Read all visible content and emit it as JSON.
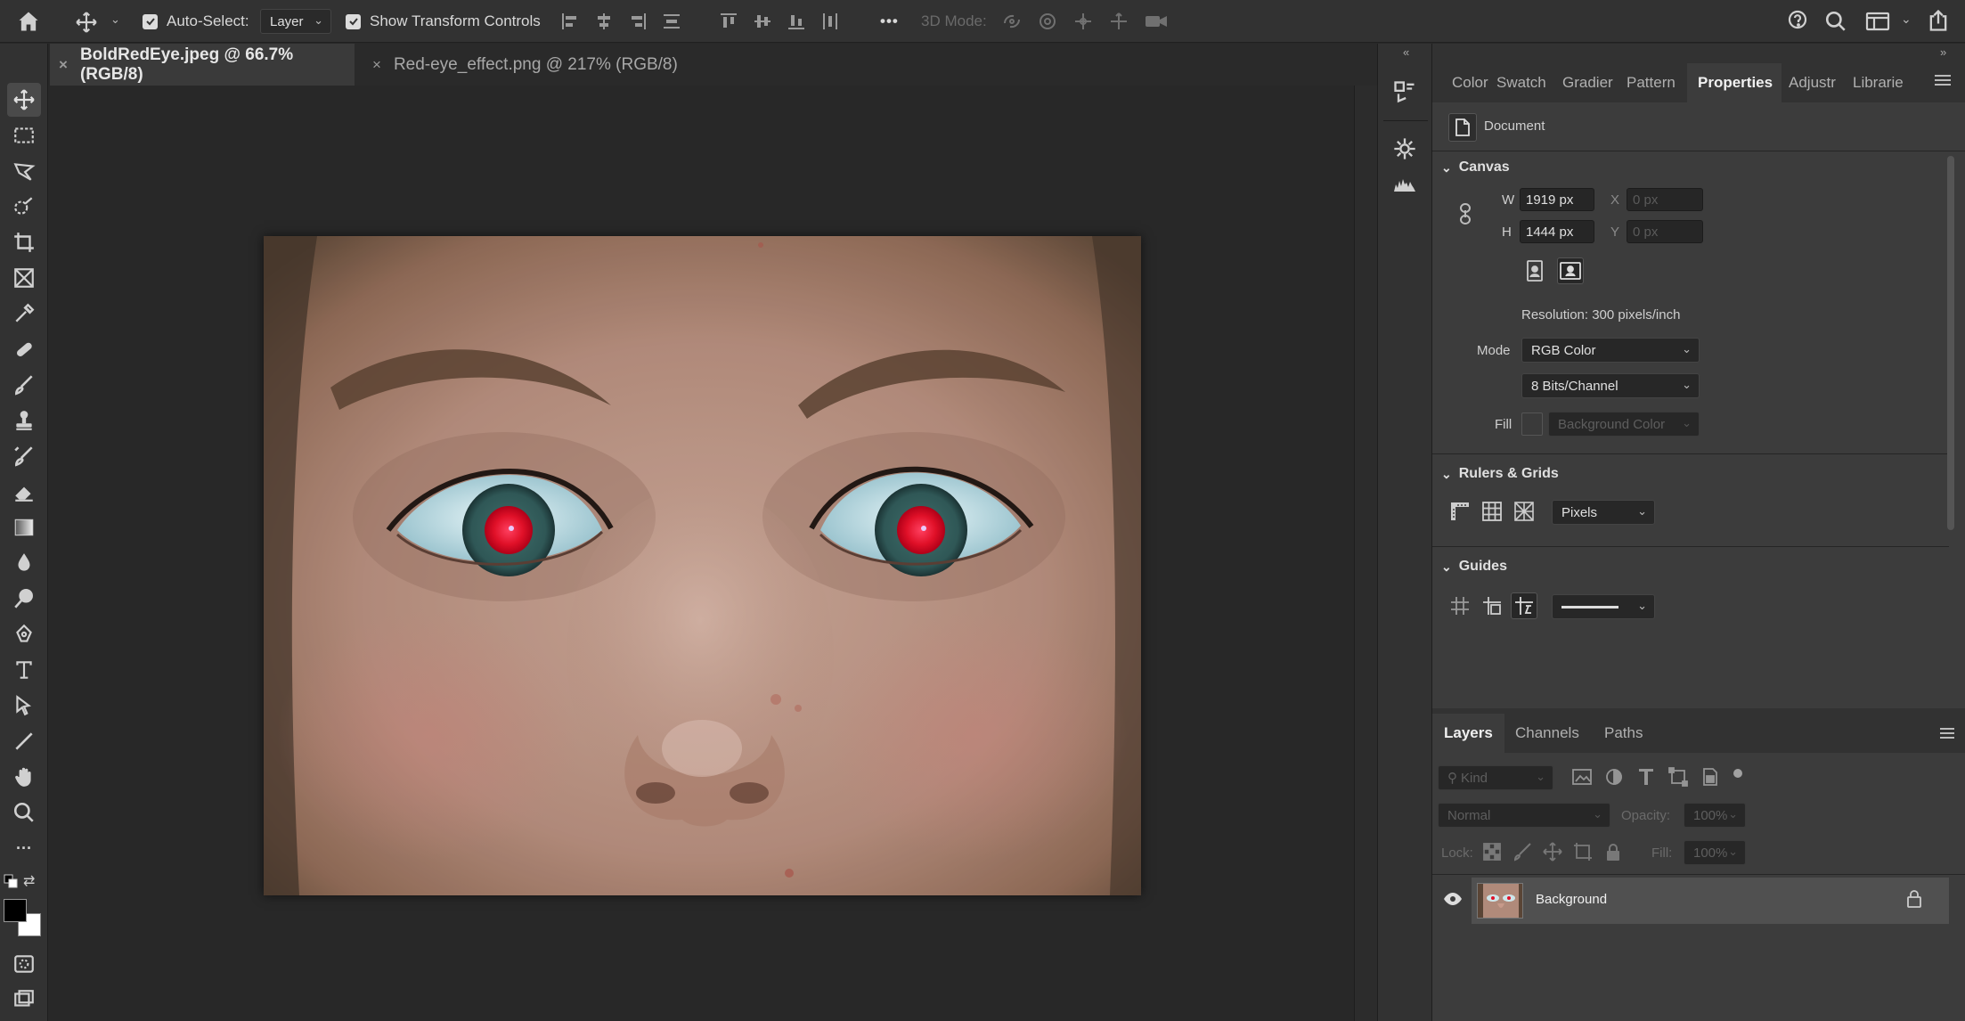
{
  "options_bar": {
    "auto_select_label": "Auto-Select:",
    "auto_select_value": "Layer",
    "show_transform_label": "Show Transform Controls",
    "more": "•••",
    "mode_3d_label": "3D Mode:"
  },
  "documents": {
    "tabs": [
      {
        "close": "×",
        "label": "BoldRedEye.jpeg @ 66.7% (RGB/8)"
      },
      {
        "close": "×",
        "label": "Red-eye_effect.png @ 217% (RGB/8)"
      }
    ]
  },
  "panel_tabs": [
    "Color",
    "Swatch",
    "Gradier",
    "Pattern",
    "Properties",
    "Adjustr",
    "Librarie"
  ],
  "properties": {
    "kind_label": "Document",
    "canvas": {
      "title": "Canvas",
      "w_label": "W",
      "w_value": "1919 px",
      "h_label": "H",
      "h_value": "1444 px",
      "x_label": "X",
      "x_value": "0 px",
      "y_label": "Y",
      "y_value": "0 px",
      "resolution": "Resolution: 300 pixels/inch",
      "mode_label": "Mode",
      "mode_value": "RGB Color",
      "depth_value": "8 Bits/Channel",
      "fill_label": "Fill",
      "fill_value": "Background Color"
    },
    "rulers": {
      "title": "Rulers & Grids",
      "units": "Pixels"
    },
    "guides": {
      "title": "Guides"
    }
  },
  "layers_panel": {
    "tabs": [
      "Layers",
      "Channels",
      "Paths"
    ],
    "kind_placeholder": "Kind",
    "blend_mode": "Normal",
    "opacity_label": "Opacity:",
    "opacity_value": "100%",
    "lock_label": "Lock:",
    "fill_label": "Fill:",
    "fill_value": "100%",
    "layers": [
      {
        "name": "Background"
      }
    ]
  },
  "colors": {
    "ui_bg": "#323232",
    "canvas_bg": "#282828",
    "active_tab": "#3c3c3c",
    "foreground_swatch": "#000000",
    "background_swatch": "#ffffff"
  }
}
